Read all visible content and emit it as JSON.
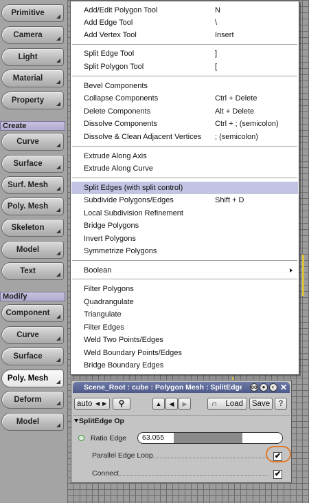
{
  "sidebar": {
    "top_items": [
      "Primitive",
      "Camera",
      "Light",
      "Material",
      "Property"
    ],
    "create_header": "Create",
    "create_items": [
      "Curve",
      "Surface",
      "Surf. Mesh",
      "Poly. Mesh",
      "Skeleton",
      "Model",
      "Text"
    ],
    "modify_header": "Modify",
    "modify_items": [
      "Component",
      "Curve",
      "Surface",
      "Poly. Mesh",
      "Deform",
      "Model"
    ],
    "active_item": "Poly. Mesh"
  },
  "menu": {
    "items": [
      {
        "label": "Add/Edit Polygon Tool",
        "shortcut": "N"
      },
      {
        "label": "Add Edge Tool",
        "shortcut": "\\"
      },
      {
        "label": "Add Vertex Tool",
        "shortcut": "Insert"
      },
      {
        "label": "Split Edge Tool",
        "shortcut": "]"
      },
      {
        "label": "Split Polygon Tool",
        "shortcut": "["
      },
      {
        "label": "Bevel Components",
        "shortcut": ""
      },
      {
        "label": "Collapse Components",
        "shortcut": "Ctrl + Delete"
      },
      {
        "label": "Delete Components",
        "shortcut": "Alt + Delete"
      },
      {
        "label": "Dissolve Components",
        "shortcut": "Ctrl + ; (semicolon)"
      },
      {
        "label": "Dissolve & Clean Adjacent Vertices",
        "shortcut": "; (semicolon)"
      },
      {
        "label": "Extrude Along Axis",
        "shortcut": ""
      },
      {
        "label": "Extrude Along Curve",
        "shortcut": ""
      },
      {
        "label": "Split Edges (with split control)",
        "shortcut": ""
      },
      {
        "label": "Subdivide Polygons/Edges",
        "shortcut": "Shift + D"
      },
      {
        "label": "Local Subdivision Refinement",
        "shortcut": ""
      },
      {
        "label": "Bridge Polygons",
        "shortcut": ""
      },
      {
        "label": "Invert Polygons",
        "shortcut": ""
      },
      {
        "label": "Symmetrize Polygons",
        "shortcut": ""
      },
      {
        "label": "Boolean",
        "shortcut": ""
      },
      {
        "label": "Filter Polygons",
        "shortcut": ""
      },
      {
        "label": "Quadrangulate",
        "shortcut": ""
      },
      {
        "label": "Triangulate",
        "shortcut": ""
      },
      {
        "label": "Filter Edges",
        "shortcut": ""
      },
      {
        "label": "Weld Two Points/Edges",
        "shortcut": ""
      },
      {
        "label": "Weld Boundary Points/Edges",
        "shortcut": ""
      },
      {
        "label": "Bridge Boundary Edges",
        "shortcut": ""
      }
    ],
    "highlighted_item": "Split Edges (with split control)",
    "submenu_item": "Boolean",
    "highlight_color": "#c3c4e3"
  },
  "panel": {
    "title": "Scene_Root : cube : Polygon Mesh : SplitEdge",
    "toolbar": {
      "auto_label": "auto",
      "load_label": "Load",
      "save_label": "Save",
      "help_label": "?"
    },
    "section_title": "SplitEdge Op",
    "ratio_label": "Ratio Edge",
    "ratio_value": "63.055",
    "ratio_fraction": 0.63,
    "parallel_label": "Parallel Edge Loop",
    "parallel_checked": true,
    "connect_label": "Connect",
    "connect_checked": true,
    "check_mark": "✔",
    "title_bar_color": "#5a66a0",
    "annotation_color": "#e07a2a"
  }
}
